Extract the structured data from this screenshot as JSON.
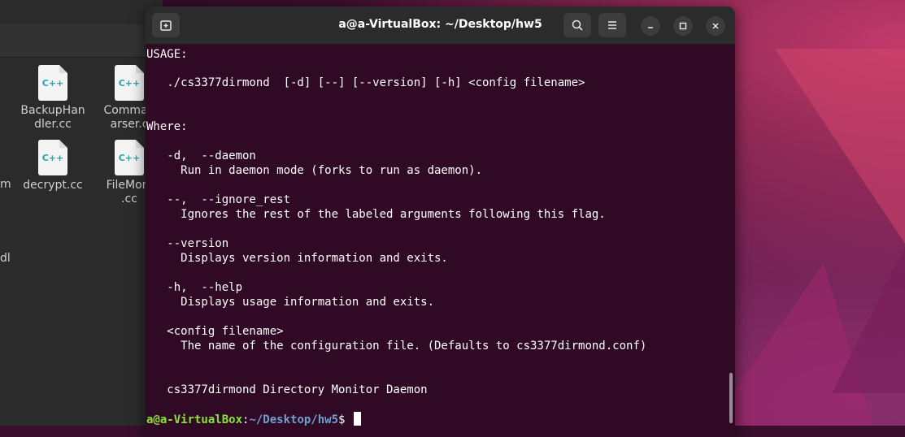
{
  "file_manager": {
    "items": [
      {
        "icon_text": "C++",
        "name": "BackupHandler.cc"
      },
      {
        "icon_text": "C++",
        "name": "CommandParser.cc"
      },
      {
        "icon_text": "C++",
        "name": "decrypt.cc"
      },
      {
        "icon_text": "C++",
        "name": "FileMonitor.cc"
      }
    ],
    "labels": {
      "backup_line1": "BackupHan",
      "backup_line2": "dler.cc",
      "command_line1": "Comman",
      "command_line2": "arser.c",
      "decrypt": "decrypt.cc",
      "filemon_line1": "FileMoni",
      "filemon_line2": ".cc"
    },
    "fragments": {
      "left_m": "m",
      "left_dl": "dl"
    }
  },
  "terminal": {
    "title": "a@a-VirtualBox: ~/Desktop/hw5",
    "buttons": {
      "new_tab_icon": "new-tab-icon",
      "search_icon": "search-icon",
      "menu_icon": "hamburger-menu-icon",
      "minimize_icon": "minimize-icon",
      "maximize_icon": "maximize-icon",
      "close_icon": "close-icon"
    },
    "lines": [
      "USAGE:",
      "",
      "   ./cs3377dirmond  [-d] [--] [--version] [-h] <config filename>",
      "",
      "",
      "Where:",
      "",
      "   -d,  --daemon",
      "     Run in daemon mode (forks to run as daemon).",
      "",
      "   --,  --ignore_rest",
      "     Ignores the rest of the labeled arguments following this flag.",
      "",
      "   --version",
      "     Displays version information and exits.",
      "",
      "   -h,  --help",
      "     Displays usage information and exits.",
      "",
      "   <config filename>",
      "     The name of the configuration file. (Defaults to cs3377dirmond.conf)",
      "",
      "",
      "   cs3377dirmond Directory Monitor Daemon",
      ""
    ],
    "prompt": {
      "user_host": "a@a-VirtualBox",
      "sep": ":",
      "path": "~/Desktop/hw5",
      "symbol": "$ "
    }
  },
  "colors": {
    "terminal_bg": "#300a24",
    "prompt_user": "#8ae234",
    "prompt_path": "#729fcf"
  }
}
